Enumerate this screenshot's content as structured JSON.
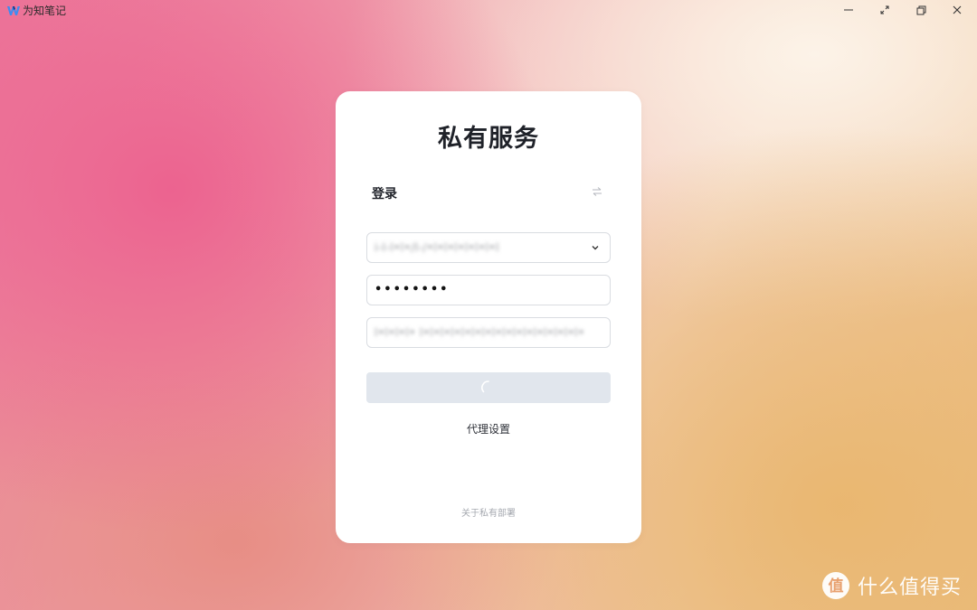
{
  "window": {
    "app_title": "为知笔记",
    "controls": [
      "minimize-icon",
      "expand-icon",
      "restore-icon",
      "close-icon"
    ]
  },
  "login_card": {
    "title": "私有服务",
    "login_label": "登录",
    "server_select": {
      "value": "i-l-l•l•/l-/•l•l•l•l•l•l•l",
      "selected_icon": "chevron-down-icon"
    },
    "password": {
      "value": "••••••••"
    },
    "server_url": {
      "value": "l•l•l•l• l•l•l•l•l•l•l•l•l•l•l•l•l•l•l•l•"
    },
    "submit": {
      "state": "loading",
      "icon": "spinner-icon"
    },
    "proxy_settings_label": "代理设置",
    "about_label": "关于私有部署"
  },
  "watermark": {
    "text": "什么值得买"
  },
  "colors": {
    "card_bg": "#ffffff",
    "submit_bg": "#e1e6ed",
    "title_text": "#1f2229",
    "muted_text": "#a6a9b0",
    "logo_blue": "#3f8cf0",
    "logo_dark": "#1b3a8a"
  }
}
